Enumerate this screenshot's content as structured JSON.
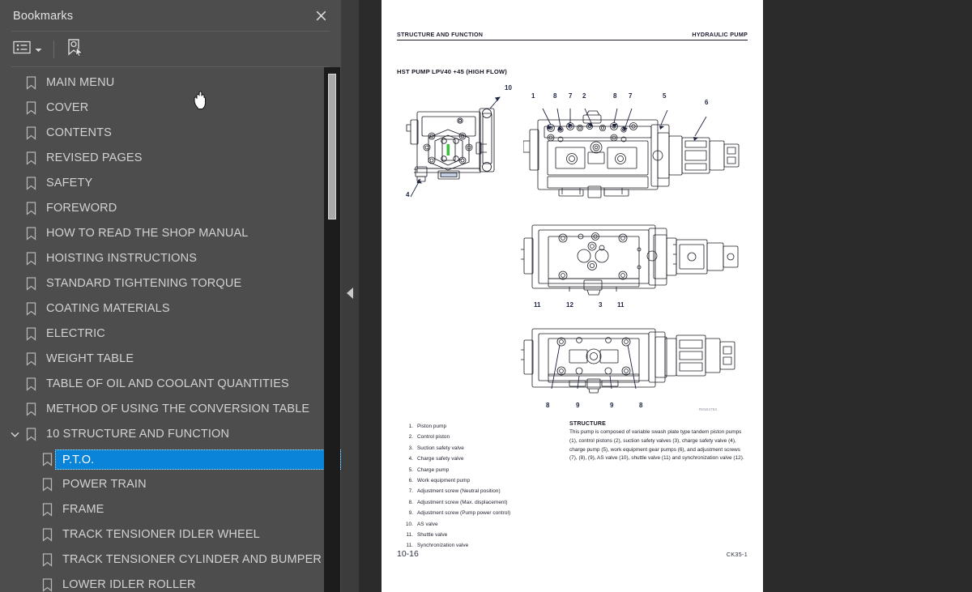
{
  "sidebar": {
    "title": "Bookmarks",
    "close_icon": "close-icon",
    "toolbar": {
      "list_view_icon": "list-options-icon",
      "caret_icon": "chevron-down-icon",
      "find_bookmark_icon": "find-bookmark-icon"
    },
    "items": [
      {
        "label": "MAIN MENU",
        "level": 0,
        "expandable": false,
        "selected": false
      },
      {
        "label": "COVER",
        "level": 0,
        "expandable": false,
        "selected": false
      },
      {
        "label": "CONTENTS",
        "level": 0,
        "expandable": false,
        "selected": false
      },
      {
        "label": "REVISED PAGES",
        "level": 0,
        "expandable": false,
        "selected": false
      },
      {
        "label": "SAFETY",
        "level": 0,
        "expandable": false,
        "selected": false
      },
      {
        "label": "FOREWORD",
        "level": 0,
        "expandable": false,
        "selected": false
      },
      {
        "label": "HOW TO READ THE SHOP MANUAL",
        "level": 0,
        "expandable": false,
        "selected": false
      },
      {
        "label": "HOISTING INSTRUCTIONS",
        "level": 0,
        "expandable": false,
        "selected": false
      },
      {
        "label": "STANDARD TIGHTENING TORQUE",
        "level": 0,
        "expandable": false,
        "selected": false
      },
      {
        "label": "COATING MATERIALS",
        "level": 0,
        "expandable": false,
        "selected": false
      },
      {
        "label": "ELECTRIC",
        "level": 0,
        "expandable": false,
        "selected": false
      },
      {
        "label": "WEIGHT TABLE",
        "level": 0,
        "expandable": false,
        "selected": false
      },
      {
        "label": "TABLE OF OIL AND COOLANT QUANTITIES",
        "level": 0,
        "expandable": false,
        "selected": false
      },
      {
        "label": "METHOD OF USING THE CONVERSION TABLE",
        "level": 0,
        "expandable": false,
        "selected": false
      },
      {
        "label": "10 STRUCTURE AND FUNCTION",
        "level": 0,
        "expandable": true,
        "expanded": true,
        "selected": false
      },
      {
        "label": "P.T.O.",
        "level": 1,
        "expandable": false,
        "selected": true
      },
      {
        "label": "POWER TRAIN",
        "level": 1,
        "expandable": false,
        "selected": false
      },
      {
        "label": "FRAME",
        "level": 1,
        "expandable": false,
        "selected": false
      },
      {
        "label": "TRACK TENSIONER IDLER WHEEL",
        "level": 1,
        "expandable": false,
        "selected": false
      },
      {
        "label": "TRACK TENSIONER CYLINDER AND BUMPER SPRING",
        "level": 1,
        "expandable": false,
        "selected": false
      },
      {
        "label": "LOWER IDLER ROLLER",
        "level": 1,
        "expandable": false,
        "selected": false
      }
    ],
    "colors": {
      "panel_bg": "#4d4d4d",
      "selection": "#0a84d8",
      "text": "#d2d2d2",
      "scrollbar_track": "#1c1c1c",
      "scrollbar_thumb": "#a9a9a9"
    }
  },
  "splitter": {
    "collapse_icon": "triangle-left-icon"
  },
  "viewer": {
    "background": "#2b2b2b"
  },
  "page": {
    "running_head_left": "STRUCTURE AND FUNCTION",
    "running_head_right": "HYDRAULIC PUMP",
    "section_title": "HST PUMP LPV40 +45 (HIGH FLOW)",
    "figure_callouts_top_left": [
      "10",
      "4"
    ],
    "figure_callouts_top_right": [
      "1",
      "8",
      "7",
      "2",
      "8",
      "7",
      "5",
      "6"
    ],
    "figure_callouts_middle": [
      "11",
      "12",
      "3",
      "11"
    ],
    "figure_callouts_bottom": [
      "8",
      "9",
      "9",
      "8"
    ],
    "drawing_code": "RK504763",
    "legend": [
      {
        "num": "1.",
        "text": "Piston pump"
      },
      {
        "num": "2.",
        "text": "Control piston"
      },
      {
        "num": "3.",
        "text": "Suction safety valve"
      },
      {
        "num": "4.",
        "text": "Charge safety valve"
      },
      {
        "num": "5.",
        "text": "Charge pump"
      },
      {
        "num": "6.",
        "text": "Work equipment pump"
      },
      {
        "num": "7.",
        "text": "Adjustment screw (Neutral position)"
      },
      {
        "num": "8.",
        "text": "Adjustment screw (Max. displacement)"
      },
      {
        "num": "9.",
        "text": "Adjustment screw (Pump power control)"
      },
      {
        "num": "10.",
        "text": "AS valve"
      },
      {
        "num": "11.",
        "text": "Shuttle valve"
      },
      {
        "num": "11.",
        "text": "Synchronization valve"
      }
    ],
    "structure_heading": "STRUCTURE",
    "structure_body": "This pump is composed of variable swash plate type tandem piston pumps (1), control pistons (2), suction safety valves (3), charge safety valve (4), charge pump (5), work equipment gear pumps (6), and adjustment screws (7), (8), (9), AS valve (10), shuttle valve (11) and synchronization valve (12).",
    "footer_left": "10-16",
    "footer_right": "CK35-1"
  },
  "cursor": {
    "type": "pointing-hand"
  }
}
